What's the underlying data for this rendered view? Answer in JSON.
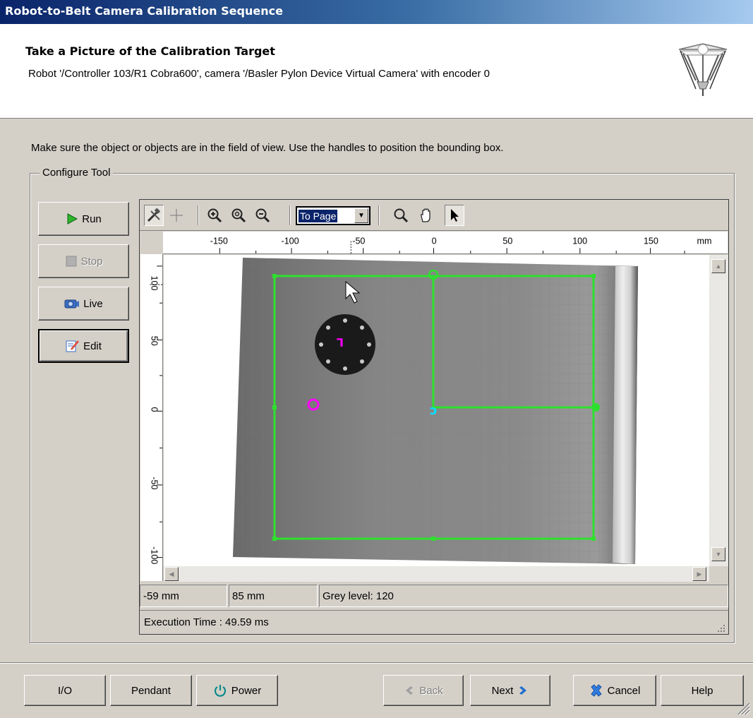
{
  "window": {
    "title": "Robot-to-Belt Camera Calibration Sequence"
  },
  "header": {
    "title": "Take a Picture of the Calibration Target",
    "subtitle": "Robot '/Controller 103/R1 Cobra600', camera '/Basler Pylon Device Virtual Camera' with encoder 0",
    "icon": "delta-robot-icon"
  },
  "instruction": "Make sure the object or objects are in the field of view. Use the handles to position the bounding box.",
  "group": {
    "label": "Configure Tool"
  },
  "side_buttons": {
    "run": "Run",
    "stop": "Stop",
    "live": "Live",
    "edit": "Edit"
  },
  "toolbar": {
    "zoom_value": "To Page",
    "icons": [
      "tools-icon",
      "crosshair-icon",
      "zoom-in-icon",
      "zoom-fit-icon",
      "zoom-out-icon",
      "magnify-icon",
      "pan-hand-icon",
      "pointer-icon"
    ]
  },
  "rulers": {
    "h_ticks": [
      "-150",
      "-100",
      "-50",
      "0",
      "50",
      "100",
      "150"
    ],
    "h_unit": "mm",
    "v_ticks": [
      "100",
      "50",
      "0",
      "-50",
      "-100"
    ]
  },
  "status": {
    "x": "-59 mm",
    "y": "85 mm",
    "grey": "Grey level: 120",
    "exec_time": "Execution Time : 49.59 ms"
  },
  "footer": {
    "io": "I/O",
    "pendant": "Pendant",
    "power": "Power",
    "back": "Back",
    "next": "Next",
    "cancel": "Cancel",
    "help": "Help"
  },
  "colors": {
    "bounding_box": "#2ee02e",
    "target_marker": "#ff00ff",
    "origin_marker": "#00e0ff"
  }
}
